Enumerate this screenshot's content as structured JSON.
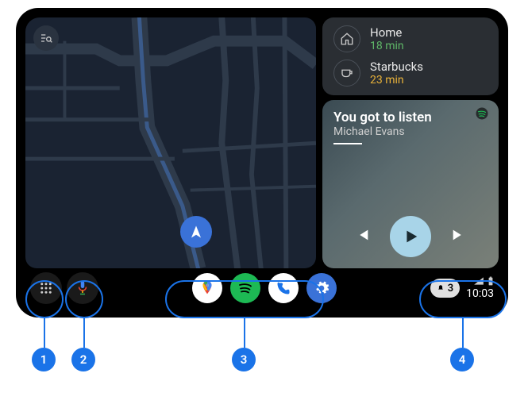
{
  "map": {
    "search_icon": "search-list"
  },
  "destinations": [
    {
      "icon": "home",
      "name": "Home",
      "eta": "18 min",
      "eta_color": "#5fb768"
    },
    {
      "icon": "cup",
      "name": "Starbucks",
      "eta": "23 min",
      "eta_color": "#e8b23a"
    }
  ],
  "media": {
    "app_icon": "spotify",
    "title": "You got to listen",
    "artist": "Michael Evans",
    "progress_pct": 18
  },
  "navbar": {
    "launcher_icon": "grid",
    "mic_icon": "mic",
    "apps": [
      {
        "id": "maps",
        "icon": "google-maps"
      },
      {
        "id": "spotify",
        "icon": "spotify"
      },
      {
        "id": "phone",
        "icon": "phone"
      },
      {
        "id": "settings",
        "icon": "gear"
      }
    ],
    "notification_count": "3",
    "clock": "10:03"
  },
  "annotations": {
    "1": "1",
    "2": "2",
    "3": "3",
    "4": "4"
  },
  "colors": {
    "accent": "#1a73e8",
    "map_bg": "#1a2332",
    "spotify_green": "#1db954"
  }
}
